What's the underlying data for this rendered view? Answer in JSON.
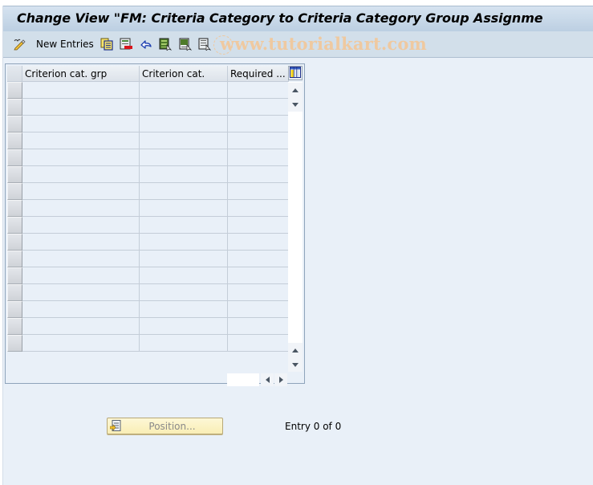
{
  "window": {
    "title": "Change View \"FM: Criteria Category to Criteria Category Group Assignme"
  },
  "toolbar": {
    "items": [
      {
        "name": "display-change-icon",
        "label": ""
      },
      {
        "name": "new-entries-button",
        "label": "New Entries"
      },
      {
        "name": "copy-as-icon",
        "label": ""
      },
      {
        "name": "delete-icon",
        "label": ""
      },
      {
        "name": "undo-change-icon",
        "label": ""
      },
      {
        "name": "select-all-icon",
        "label": ""
      },
      {
        "name": "select-block-icon",
        "label": ""
      },
      {
        "name": "deselect-all-icon",
        "label": ""
      }
    ],
    "new_entries_label": "New Entries"
  },
  "watermark": "www.tutorialkart.com",
  "table": {
    "columns": [
      "Criterion cat. grp",
      "Criterion cat.",
      "Required ..."
    ],
    "row_count": 16,
    "rows": []
  },
  "footer": {
    "position_label": "Position...",
    "entry_text": "Entry 0 of 0"
  },
  "colors": {
    "background": "#e9f0f8",
    "titlebar": "#c8d8e8",
    "toolbar": "#d2dfea",
    "position_button": "#fbf2c4",
    "watermark": "#efc9a0"
  }
}
